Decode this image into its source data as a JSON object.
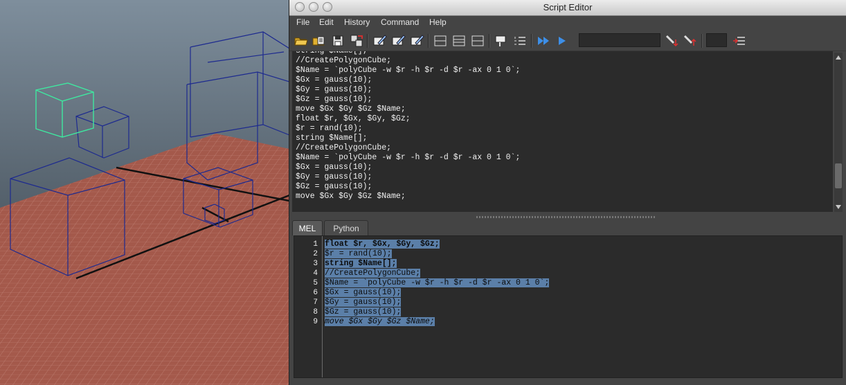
{
  "window": {
    "title": "Script Editor"
  },
  "menu": [
    "File",
    "Edit",
    "History",
    "Command",
    "Help"
  ],
  "toolbar": {
    "icons": [
      "open-script-icon",
      "source-script-icon",
      "save-script-icon",
      "save-to-shelf-icon",
      "clear-history-icon",
      "clear-input-icon",
      "clear-all-icon",
      "show-history-only-icon",
      "show-input-only-icon",
      "show-both-icon",
      "echo-all-commands-icon",
      "line-numbers-icon",
      "execute-all-icon",
      "execute-icon",
      "search-down-icon",
      "search-up-icon",
      "goto-line-icon"
    ],
    "search_value": "",
    "goto_line_value": ""
  },
  "history": {
    "lines": [
      "string $Name[];",
      "//CreatePolygonCube;",
      "$Name = `polyCube -w $r -h $r -d $r -ax 0 1 0`;",
      "$Gx = gauss(10);",
      "$Gy = gauss(10);",
      "$Gz = gauss(10);",
      "move $Gx $Gy $Gz $Name;",
      "float $r, $Gx, $Gy, $Gz;",
      "$r = rand(10);",
      "string $Name[];",
      "//CreatePolygonCube;",
      "$Name = `polyCube -w $r -h $r -d $r -ax 0 1 0`;",
      "$Gx = gauss(10);",
      "$Gy = gauss(10);",
      "$Gz = gauss(10);",
      "move $Gx $Gy $Gz $Name;"
    ]
  },
  "tabs": [
    {
      "label": "MEL"
    },
    {
      "label": "Python"
    }
  ],
  "input": {
    "line_numbers": [
      "1",
      "2",
      "3",
      "4",
      "5",
      "6",
      "7",
      "8",
      "9"
    ],
    "lines": [
      "float $r, $Gx, $Gy, $Gz;",
      "$r = rand(10);",
      "string $Name[];",
      "//CreatePolygonCube;",
      "$Name = `polyCube -w $r -h $r -d $r -ax 0 1 0`;",
      "$Gx = gauss(10);",
      "$Gy = gauss(10);",
      "$Gz = gauss(10);",
      "move $Gx $Gy $Gz $Name;"
    ]
  },
  "colors": {
    "panel": "#444444",
    "text_field": "#2b2b2b",
    "selection": "#5b7fa8",
    "grid_floor": "#a0584a",
    "wire_blue": "#1d2a8f",
    "wire_selected": "#3fe8a0"
  }
}
